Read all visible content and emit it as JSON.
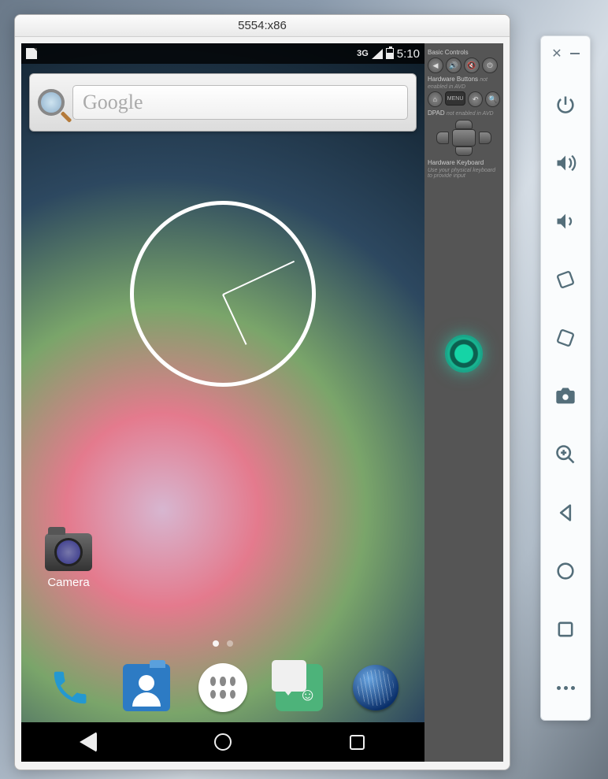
{
  "window": {
    "title": "5554:x86"
  },
  "status": {
    "network": "3G",
    "time": "5:10"
  },
  "search": {
    "placeholder": "Google"
  },
  "apps": {
    "camera_label": "Camera"
  },
  "dock_items": [
    "phone",
    "contacts",
    "apps",
    "messaging",
    "browser"
  ],
  "old_panel": {
    "basic_label": "Basic Controls",
    "hw_label": "Hardware Buttons",
    "hw_note": "not enabled in AVD",
    "dpad_label": "DPAD",
    "dpad_note": "not enabled in AVD",
    "kbd_label": "Hardware Keyboard",
    "kbd_note": "Use your physical keyboard to provide input",
    "menu_label": "MENU"
  },
  "toolbar_items": [
    "close",
    "minimize",
    "power",
    "volume-up",
    "volume-down",
    "rotate-ccw",
    "rotate-cw",
    "camera",
    "zoom",
    "back",
    "home",
    "overview",
    "more"
  ]
}
